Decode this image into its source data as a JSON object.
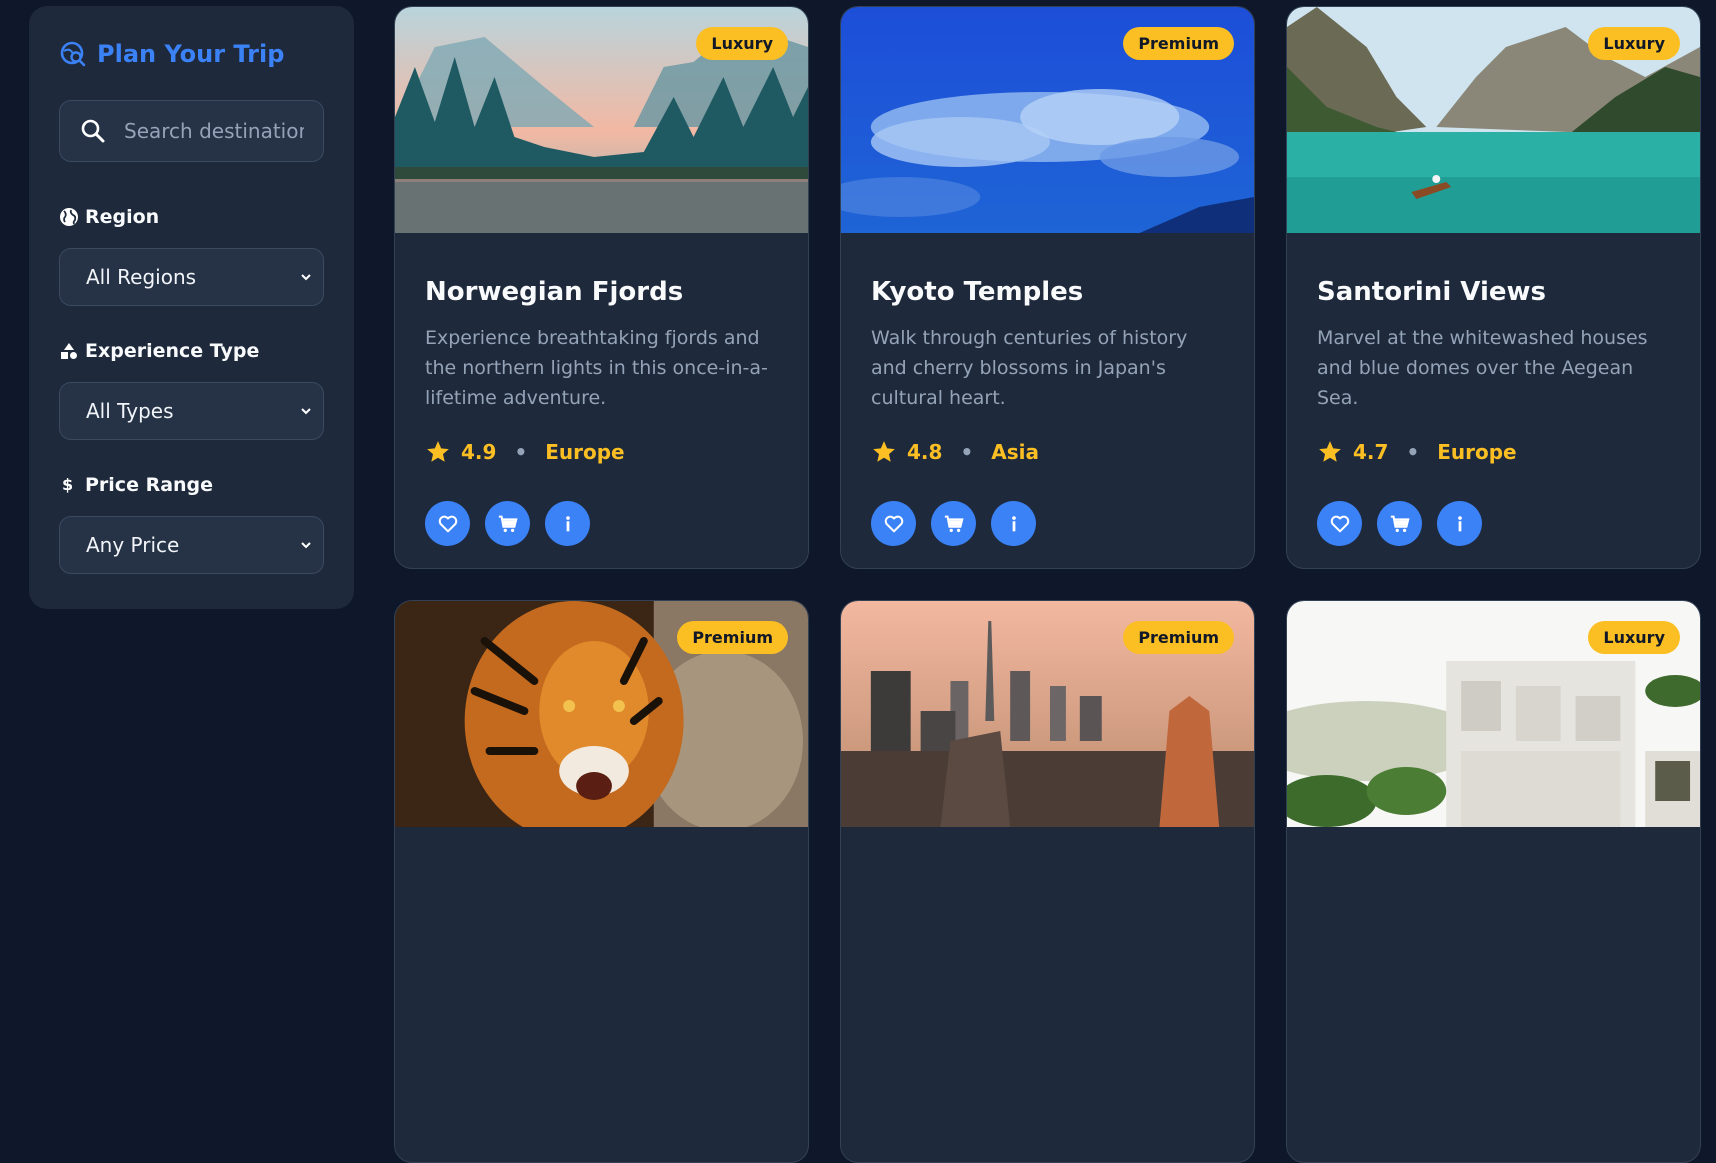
{
  "sidebar": {
    "title": "Plan Your Trip",
    "search_placeholder": "Search destinations...",
    "filters": [
      {
        "label": "Region",
        "icon": "globe-icon",
        "value": "All Regions"
      },
      {
        "label": "Experience Type",
        "icon": "shapes-icon",
        "value": "All Types"
      },
      {
        "label": "Price Range",
        "icon": "dollar-icon",
        "value": "Any Price"
      }
    ]
  },
  "cards": [
    {
      "title": "Norwegian Fjords",
      "badge": "Luxury",
      "description": "Experience breathtaking fjords and the northern lights in this once-in-a-lifetime adventure.",
      "rating": "4.9",
      "region": "Europe",
      "image": "forest-lake"
    },
    {
      "title": "Kyoto Temples",
      "badge": "Premium",
      "description": "Walk through centuries of history and cherry blossoms in Japan's cultural heart.",
      "rating": "4.8",
      "region": "Asia",
      "image": "blue-clouds"
    },
    {
      "title": "Santorini Views",
      "badge": "Luxury",
      "description": "Marvel at the whitewashed houses and blue domes over the Aegean Sea.",
      "rating": "4.7",
      "region": "Europe",
      "image": "mountain-lake-boat"
    },
    {
      "badge": "Premium",
      "image": "tiger"
    },
    {
      "badge": "Premium",
      "image": "city-skyline"
    },
    {
      "badge": "Luxury",
      "image": "white-building"
    }
  ],
  "colors": {
    "background": "#0f172a",
    "panel": "#1e293b",
    "accent": "#3b82f6",
    "gold": "#fbbf24",
    "muted_text": "#94a3b8"
  }
}
